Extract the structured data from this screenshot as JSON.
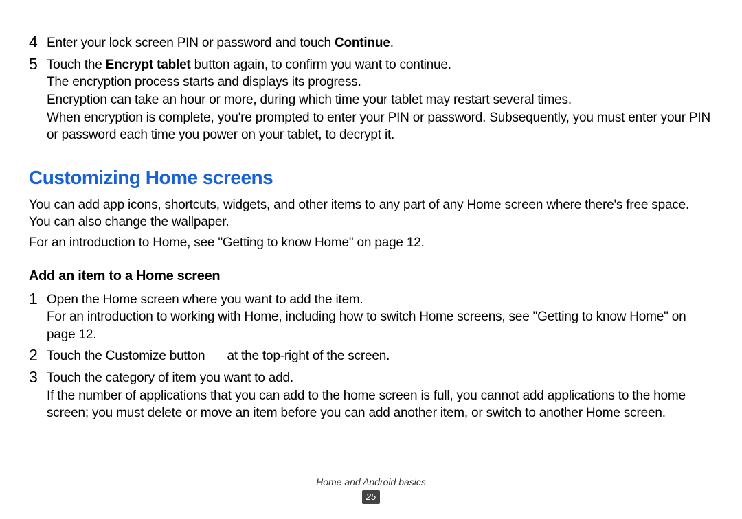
{
  "steps_top": [
    {
      "num": "4",
      "parts": [
        {
          "text": "Enter your lock screen PIN or password and touch ",
          "bold": false
        },
        {
          "text": "Continue",
          "bold": true
        },
        {
          "text": ".",
          "bold": false
        }
      ]
    },
    {
      "num": "5",
      "lines": [
        [
          {
            "text": "Touch the ",
            "bold": false
          },
          {
            "text": "Encrypt tablet",
            "bold": true
          },
          {
            "text": " button again, to confirm you want to continue.",
            "bold": false
          }
        ],
        [
          {
            "text": "The encryption process starts and displays its progress.",
            "bold": false
          }
        ],
        [
          {
            "text": "Encryption can take an hour or more, during which time your tablet may restart several times.",
            "bold": false
          }
        ],
        [
          {
            "text": "When encryption is complete, you're prompted to enter your PIN or password. Subsequently, you must enter your PIN or password each time you power on your tablet, to decrypt it.",
            "bold": false
          }
        ]
      ]
    }
  ],
  "section_title": "Customizing Home screens",
  "section_body": [
    "You can add app icons, shortcuts, widgets, and other items to any part of any Home screen where there's free space. You can also change the wallpaper.",
    "For an introduction to Home, see \"Getting to know Home\" on page 12."
  ],
  "sub_title": "Add an item to a Home screen",
  "steps_sub": [
    {
      "num": "1",
      "lines": [
        [
          {
            "text": "Open the Home screen where you want to add the item.",
            "bold": false
          }
        ],
        [
          {
            "text": "For an introduction to working with Home, including how to switch Home screens, see \"Getting to know Home\" on page 12.",
            "bold": false
          }
        ]
      ]
    },
    {
      "num": "2",
      "parts": [
        {
          "text": "Touch the Customize button ",
          "bold": false,
          "icon_gap": true
        },
        {
          "text": " at the top-right of the screen.",
          "bold": false
        }
      ]
    },
    {
      "num": "3",
      "lines": [
        [
          {
            "text": "Touch the category of item you want to add.",
            "bold": false
          }
        ],
        [
          {
            "text": "If the number of applications that you can add to the home screen is full, you cannot add applications to the home screen; you must delete or move an item before you can add another item, or switch to another Home screen.",
            "bold": false
          }
        ]
      ]
    }
  ],
  "footer_title": "Home and Android basics",
  "page_number": "25"
}
